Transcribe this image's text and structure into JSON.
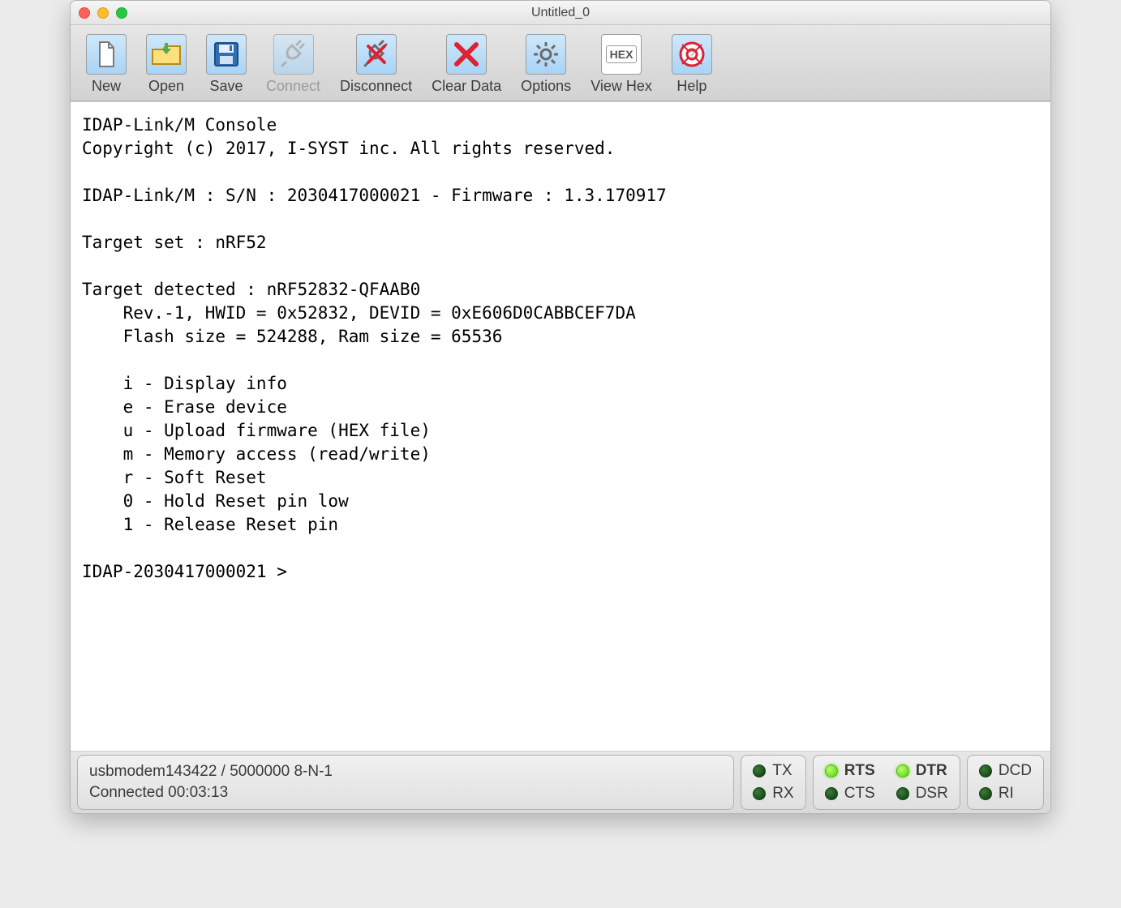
{
  "window": {
    "title": "Untitled_0"
  },
  "toolbar": {
    "new": {
      "label": "New"
    },
    "open": {
      "label": "Open"
    },
    "save": {
      "label": "Save"
    },
    "connect": {
      "label": "Connect"
    },
    "disconnect": {
      "label": "Disconnect"
    },
    "cleardata": {
      "label": "Clear Data"
    },
    "options": {
      "label": "Options"
    },
    "viewhex": {
      "label": "View Hex",
      "badge": "HEX"
    },
    "help": {
      "label": "Help"
    }
  },
  "console_text": "IDAP-Link/M Console\nCopyright (c) 2017, I-SYST inc. All rights reserved.\n\nIDAP-Link/M : S/N : 2030417000021 - Firmware : 1.3.170917\n\nTarget set : nRF52\n\nTarget detected : nRF52832-QFAAB0\n    Rev.-1, HWID = 0x52832, DEVID = 0xE606D0CABBCEF7DA\n    Flash size = 524288, Ram size = 65536\n\n    i - Display info\n    e - Erase device\n    u - Upload firmware (HEX file)\n    m - Memory access (read/write)\n    r - Soft Reset\n    0 - Hold Reset pin low\n    1 - Release Reset pin\n\nIDAP-2030417000021 >",
  "status": {
    "port_line": "usbmodem143422 / 5000000 8-N-1",
    "connected": "Connected 00:03:13",
    "tx": {
      "label": "TX",
      "on": false
    },
    "rx": {
      "label": "RX",
      "on": false
    },
    "rts": {
      "label": "RTS",
      "on": true,
      "bold": true
    },
    "cts": {
      "label": "CTS",
      "on": false
    },
    "dtr": {
      "label": "DTR",
      "on": true,
      "bold": true
    },
    "dsr": {
      "label": "DSR",
      "on": false
    },
    "dcd": {
      "label": "DCD",
      "on": false
    },
    "ri": {
      "label": "RI",
      "on": false
    }
  }
}
